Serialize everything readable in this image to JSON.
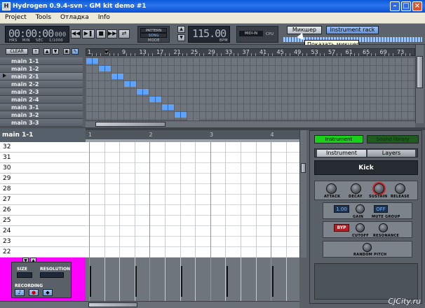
{
  "window": {
    "title": "Hydrogen 0.9.4-svn - GM kit demo #1",
    "app_icon": "hydrogen-icon"
  },
  "menu": [
    "Project",
    "Tools",
    "Отладка",
    "Info"
  ],
  "transport": {
    "time": "00:00:00",
    "time_fraction": "000",
    "time_units": [
      "HRS",
      "MIN",
      "SEC",
      "1/1000"
    ],
    "mode_options": [
      "PATTERN",
      "SONG"
    ],
    "mode_label": "MODE",
    "bpm": "115.00",
    "bpm_label": "BPM",
    "midi_in": "MIDI-IN",
    "cpu": "CPU",
    "mixer_button": "Микшер",
    "rack_button": "Instrument rack"
  },
  "tooltip": "Показать микшер",
  "song_editor": {
    "clear_button": "CLEAR",
    "ruler": [
      "1",
      "5",
      "9",
      "13",
      "17",
      "21",
      "25",
      "29",
      "33",
      "37",
      "41",
      "45",
      "49",
      "53",
      "57",
      "61",
      "65",
      "69",
      "73"
    ],
    "patterns": [
      "main 1-1",
      "main 1-2",
      "main 2-1",
      "main 2-2",
      "main 2-3",
      "main 2-4",
      "main 3-1",
      "main 3-2",
      "main 3-3"
    ]
  },
  "pattern_editor": {
    "pattern_name": "main 1-1",
    "ruler": [
      "1",
      "2",
      "3",
      "4"
    ],
    "notes": [
      "32",
      "31",
      "30",
      "29",
      "28",
      "27",
      "26",
      "25",
      "24",
      "23",
      "22"
    ],
    "size_label": "SIZE",
    "resolution_label": "RESOLUTION",
    "recording_label": "RECORDING"
  },
  "instrument_rack": {
    "tabs": [
      "Instrument",
      "Sound library"
    ],
    "subtabs": [
      "Instrument",
      "Layers"
    ],
    "instrument_name": "Kick",
    "knobs": [
      "ATTACK",
      "DECAY",
      "SUSTAIN",
      "RELEASE"
    ],
    "gain_label": "GAIN",
    "gain_value": "1.00",
    "mute_group_label": "MUTE GROUP",
    "mute_group_value": "OFF",
    "cutoff_label": "CUTOFF",
    "resonance_label": "RESONANCE",
    "filter_button": "BYP",
    "random_pitch_label": "RANDOM PITCH"
  },
  "watermark": "CJCity.ru"
}
